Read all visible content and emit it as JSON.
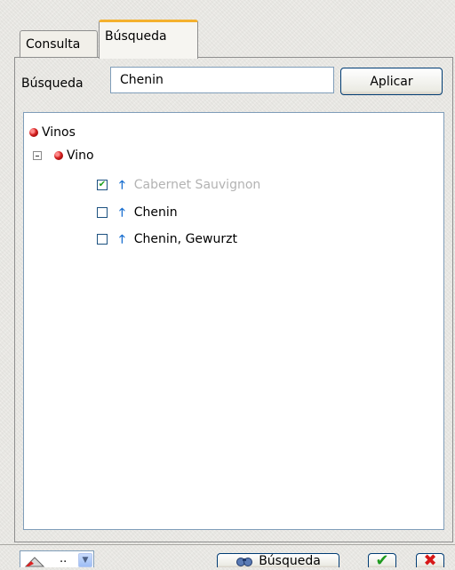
{
  "tabs": [
    {
      "label": "Consulta",
      "active": false
    },
    {
      "label": "Búsqueda",
      "active": true
    }
  ],
  "search": {
    "label": "Búsqueda",
    "value": "Chenin",
    "apply_label": "Aplicar"
  },
  "tree": {
    "root": {
      "label": "Vinos",
      "icon": "red-ball-icon"
    },
    "child": {
      "label": "Vino",
      "icon": "red-ball-icon",
      "expanded": true
    },
    "items": [
      {
        "label": "Cabernet Sauvignon",
        "checked": true,
        "disabled": true,
        "icon": "up-arrow-icon"
      },
      {
        "label": "Chenin",
        "checked": false,
        "disabled": false,
        "icon": "up-arrow-icon"
      },
      {
        "label": "Chenin, Gewurzt",
        "checked": false,
        "disabled": false,
        "icon": "up-arrow-icon"
      }
    ]
  },
  "footer": {
    "dropdown_value": "..",
    "search_button_label": "Búsqueda",
    "ok_icon": "checkmark-icon",
    "cancel_icon": "x-icon"
  },
  "colors": {
    "tab_accent": "#f4b12e",
    "ok_green": "#1f9a1f",
    "cancel_red": "#d71818",
    "arrow_blue": "#1a6fd0"
  }
}
